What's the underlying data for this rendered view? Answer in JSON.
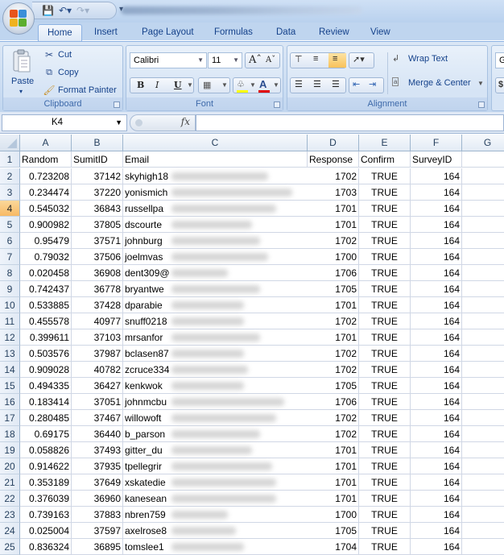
{
  "window": {
    "quick_access": [
      "save-icon",
      "undo-icon",
      "redo-icon"
    ]
  },
  "tabs": [
    {
      "label": "Home",
      "active": true
    },
    {
      "label": "Insert"
    },
    {
      "label": "Page Layout"
    },
    {
      "label": "Formulas"
    },
    {
      "label": "Data"
    },
    {
      "label": "Review"
    },
    {
      "label": "View"
    }
  ],
  "ribbon": {
    "clipboard": {
      "label": "Clipboard",
      "paste": "Paste",
      "cut": "Cut",
      "copy": "Copy",
      "format_painter": "Format Painter"
    },
    "font": {
      "label": "Font",
      "font_name": "Calibri",
      "font_size": "11",
      "fill_color": "#ffff00",
      "font_color": "#e00000"
    },
    "alignment": {
      "label": "Alignment",
      "wrap_text": "Wrap Text",
      "merge_center": "Merge & Center"
    },
    "number": {
      "format_partial": "G",
      "currency_partial": "$"
    }
  },
  "formula_bar": {
    "name_box": "K4",
    "fx": "fx",
    "value": ""
  },
  "sheet": {
    "columns": [
      "A",
      "B",
      "C",
      "D",
      "E",
      "F",
      "G"
    ],
    "active_row": 4,
    "headers": [
      "Random",
      "SumitID",
      "Email",
      "Response",
      "Confirm",
      "SurveyID",
      ""
    ],
    "rows": [
      {
        "n": "2",
        "random": "0.723208",
        "sumitid": "37142",
        "email": "skyhigh18",
        "response": "1702",
        "confirm": "TRUE",
        "surveyid": "164"
      },
      {
        "n": "3",
        "random": "0.234474",
        "sumitid": "37220",
        "email": "yonismich",
        "response": "1703",
        "confirm": "TRUE",
        "surveyid": "164"
      },
      {
        "n": "4",
        "random": "0.545032",
        "sumitid": "36843",
        "email": "russellpa",
        "response": "1701",
        "confirm": "TRUE",
        "surveyid": "164"
      },
      {
        "n": "5",
        "random": "0.900982",
        "sumitid": "37805",
        "email": "dscourte",
        "response": "1701",
        "confirm": "TRUE",
        "surveyid": "164"
      },
      {
        "n": "6",
        "random": "0.95479",
        "sumitid": "37571",
        "email": "johnburg",
        "response": "1702",
        "confirm": "TRUE",
        "surveyid": "164"
      },
      {
        "n": "7",
        "random": "0.79032",
        "sumitid": "37506",
        "email": "joelmvas",
        "response": "1700",
        "confirm": "TRUE",
        "surveyid": "164"
      },
      {
        "n": "8",
        "random": "0.020458",
        "sumitid": "36908",
        "email": "dent309@",
        "response": "1706",
        "confirm": "TRUE",
        "surveyid": "164"
      },
      {
        "n": "9",
        "random": "0.742437",
        "sumitid": "36778",
        "email": "bryantwe",
        "response": "1705",
        "confirm": "TRUE",
        "surveyid": "164"
      },
      {
        "n": "10",
        "random": "0.533885",
        "sumitid": "37428",
        "email": "dparabie",
        "response": "1701",
        "confirm": "TRUE",
        "surveyid": "164"
      },
      {
        "n": "11",
        "random": "0.455578",
        "sumitid": "40977",
        "email": "snuff0218",
        "response": "1702",
        "confirm": "TRUE",
        "surveyid": "164"
      },
      {
        "n": "12",
        "random": "0.399611",
        "sumitid": "37103",
        "email": "mrsanfor",
        "response": "1701",
        "confirm": "TRUE",
        "surveyid": "164"
      },
      {
        "n": "13",
        "random": "0.503576",
        "sumitid": "37987",
        "email": "bclasen87",
        "response": "1702",
        "confirm": "TRUE",
        "surveyid": "164"
      },
      {
        "n": "14",
        "random": "0.909028",
        "sumitid": "40782",
        "email": "zcruce334",
        "response": "1702",
        "confirm": "TRUE",
        "surveyid": "164"
      },
      {
        "n": "15",
        "random": "0.494335",
        "sumitid": "36427",
        "email": "kenkwok",
        "response": "1705",
        "confirm": "TRUE",
        "surveyid": "164"
      },
      {
        "n": "16",
        "random": "0.183414",
        "sumitid": "37051",
        "email": "johnmcbu",
        "response": "1706",
        "confirm": "TRUE",
        "surveyid": "164"
      },
      {
        "n": "17",
        "random": "0.280485",
        "sumitid": "37467",
        "email": "willowoft",
        "response": "1702",
        "confirm": "TRUE",
        "surveyid": "164"
      },
      {
        "n": "18",
        "random": "0.69175",
        "sumitid": "36440",
        "email": "b_parson",
        "response": "1702",
        "confirm": "TRUE",
        "surveyid": "164"
      },
      {
        "n": "19",
        "random": "0.058826",
        "sumitid": "37493",
        "email": "gitter_du",
        "response": "1701",
        "confirm": "TRUE",
        "surveyid": "164"
      },
      {
        "n": "20",
        "random": "0.914622",
        "sumitid": "37935",
        "email": "tpellegrir",
        "response": "1701",
        "confirm": "TRUE",
        "surveyid": "164"
      },
      {
        "n": "21",
        "random": "0.353189",
        "sumitid": "37649",
        "email": "xskatedie",
        "response": "1701",
        "confirm": "TRUE",
        "surveyid": "164"
      },
      {
        "n": "22",
        "random": "0.376039",
        "sumitid": "36960",
        "email": "kanesean",
        "response": "1701",
        "confirm": "TRUE",
        "surveyid": "164"
      },
      {
        "n": "23",
        "random": "0.739163",
        "sumitid": "37883",
        "email": "nbren759",
        "response": "1700",
        "confirm": "TRUE",
        "surveyid": "164"
      },
      {
        "n": "24",
        "random": "0.025004",
        "sumitid": "37597",
        "email": "axelrose8",
        "response": "1705",
        "confirm": "TRUE",
        "surveyid": "164"
      },
      {
        "n": "25",
        "random": "0.836324",
        "sumitid": "36895",
        "email": "tomslee1",
        "response": "1704",
        "confirm": "TRUE",
        "surveyid": "164"
      }
    ]
  }
}
